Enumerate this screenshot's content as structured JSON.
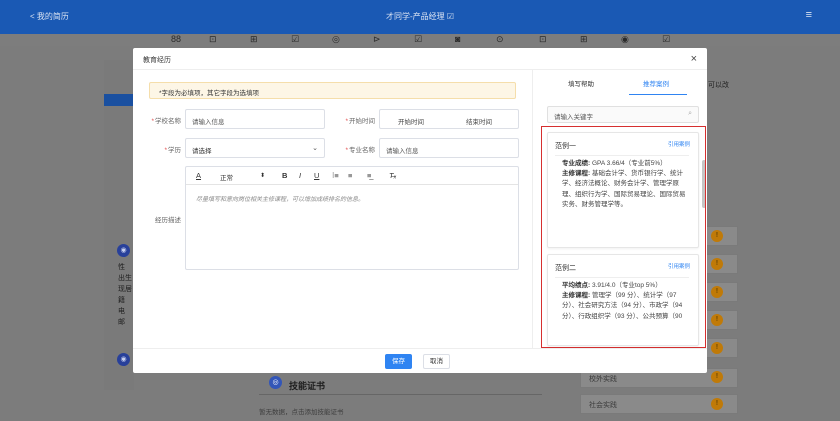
{
  "topbar": {
    "back": "< 我的简历",
    "title": "才同学-产品经理 ☑",
    "menu_icon": "≡"
  },
  "toolbar_icons": [
    "88",
    "⊡",
    "⊞",
    "☑",
    "◎",
    "⊳",
    "☑",
    "◙",
    "⊙",
    "⊡",
    "⊞",
    "◉",
    "☑"
  ],
  "background": {
    "right_hint": "可以改",
    "side_labels": [
      "性",
      "出生",
      "现居",
      "籍",
      "电",
      "邮"
    ],
    "section_title": "技能证书",
    "section_empty_text": "暂无数据，点击添加技能证书",
    "right_row_label": "社会实践",
    "right_row_label2": "校外实践",
    "badge_text": "!"
  },
  "modal": {
    "title": "教育经历",
    "close": "×",
    "notice": "*字段为必填项，其它字段为选填项",
    "school_label": "学校名称",
    "school_placeholder": "请输入信息",
    "time_label": "开始时间",
    "start_time": "开始时间",
    "end_time": "结束时间",
    "degree_label": "学历",
    "degree_value": "请选择",
    "major_label": "专业名称",
    "major_placeholder": "请输入信息",
    "desc_label": "经历描述",
    "editor": {
      "font_size": "正常",
      "placeholder": "尽量填写和意向岗位相关主修课程，可以增加成绩排名的信息。"
    },
    "save": "保存",
    "cancel": "取消"
  },
  "helper": {
    "tabs": [
      "填写帮助",
      "推荐案例"
    ],
    "active_tab": "推荐案例",
    "search_placeholder": "请输入关键字",
    "cards": [
      {
        "title": "范例一",
        "cite": "引用案例",
        "k1": "专业成绩:",
        "v1": " GPA 3.66/4（专业前5%）",
        "k2": "主修课程:",
        "v2": " 基础会计学、货币银行学、统计学、经济法概论、财务会计学、管理学原理、组织行为学、国际贸易理论、国际贸易实务、财务管理学等。"
      },
      {
        "title": "范例二",
        "cite": "引用案例",
        "k1": "平均绩点:",
        "v1": " 3.91/4.0（专业top 5%）",
        "k2": "主修课程:",
        "v2": " 管理学（99 分）、统计学（97 分）、社会研究方法（94 分）、市政学（94 分）、行政组织学（93 分）、公共预算（90"
      }
    ]
  },
  "colors": {
    "brand": "#1a59b4",
    "primary": "#2f84f2",
    "highlight": "#d62f2f",
    "required": "#e34b4b"
  }
}
